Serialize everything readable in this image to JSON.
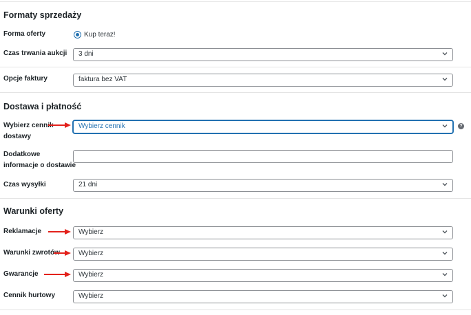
{
  "sections": {
    "sale_formats": {
      "title": "Formaty sprzedaży"
    },
    "delivery": {
      "title": "Dostawa i płatność"
    },
    "offer_terms": {
      "title": "Warunki oferty"
    }
  },
  "fields": {
    "offer_form": {
      "label": "Forma oferty",
      "option": "Kup teraz!",
      "selected": true
    },
    "auction_duration": {
      "label": "Czas trwania aukcji",
      "value": "3 dni"
    },
    "invoice_options": {
      "label": "Opcje faktury",
      "value": "faktura bez VAT"
    },
    "shipping_price_list": {
      "label_line1": "Wybierz cennik",
      "label_line2": "dostawy",
      "value": "Wybierz cennik",
      "help_icon": "question-circle-icon"
    },
    "extra_delivery_info": {
      "label_line1": "Dodatkowe",
      "label_line2": "informacje o dostawie",
      "value": ""
    },
    "dispatch_time": {
      "label": "Czas wysyłki",
      "value": "21 dni"
    },
    "complaints": {
      "label": "Reklamacje",
      "value": "Wybierz"
    },
    "return_policy": {
      "label": "Warunki zwrotów",
      "value": "Wybierz"
    },
    "warranty": {
      "label": "Gwarancje",
      "value": "Wybierz"
    },
    "wholesale_price_list": {
      "label": "Cennik hurtowy",
      "value": "Wybierz"
    }
  },
  "colors": {
    "accent": "#2271b1",
    "annotation_arrow": "#e3211b",
    "border": "#8c8f94"
  }
}
